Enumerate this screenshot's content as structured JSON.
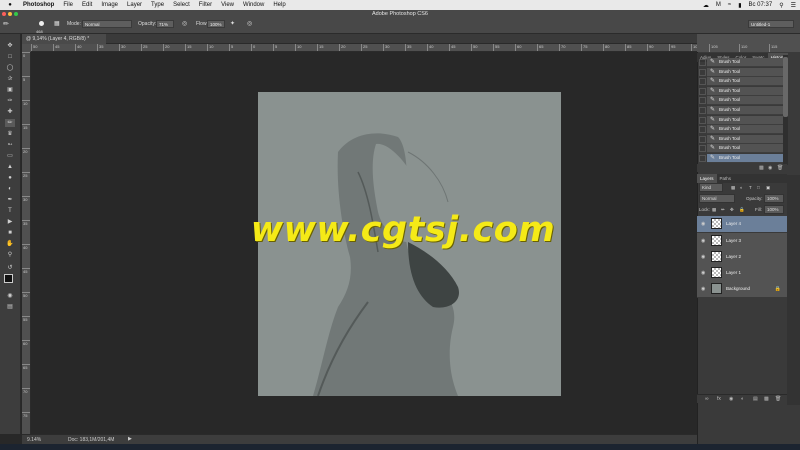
{
  "menubar": {
    "apple": "",
    "items": [
      "Photoshop",
      "File",
      "Edit",
      "Image",
      "Layer",
      "Type",
      "Select",
      "Filter",
      "View",
      "Window",
      "Help"
    ],
    "right_status": "Bc 07:37"
  },
  "window_title": "Adobe Photoshop CS6",
  "options": {
    "brush_size": "468",
    "mode_label": "Mode:",
    "mode_value": "Normal",
    "opacity_label": "Opacity:",
    "opacity_value": "71%",
    "flow_label": "Flow:",
    "flow_value": "100%",
    "workspace_value": "Untitled-1"
  },
  "document": {
    "tab_title": "@ 9,14% (Layer 4, RGB/8) *",
    "zoom": "9.14%",
    "doc_size": "Doc: 183,1M/201,4M",
    "watermark": "www.cgtsj.com"
  },
  "rulers": {
    "h_ticks": [
      "50",
      "45",
      "40",
      "35",
      "30",
      "25",
      "20",
      "15",
      "10",
      "5",
      "0",
      "5",
      "10",
      "15",
      "20",
      "25",
      "30",
      "35",
      "40",
      "45",
      "50",
      "55",
      "60",
      "65",
      "70",
      "75",
      "80",
      "85",
      "90",
      "95",
      "100"
    ],
    "right_ticks": [
      "105",
      "110",
      "115"
    ],
    "v_ticks": [
      "0",
      "5",
      "10",
      "15",
      "20",
      "25",
      "30",
      "35",
      "40",
      "45",
      "50",
      "55",
      "60",
      "65",
      "70",
      "75"
    ]
  },
  "history_panel": {
    "tabs": [
      "Adjus",
      "Styles",
      "Color",
      "Swatc",
      "History"
    ],
    "active_tab": "History",
    "items": [
      "Brush Tool",
      "Brush Tool",
      "Brush Tool",
      "Brush Tool",
      "Brush Tool",
      "Brush Tool",
      "Brush Tool",
      "Brush Tool",
      "Brush Tool",
      "Brush Tool",
      "Brush Tool"
    ]
  },
  "layers_panel": {
    "tabs": [
      "Layers",
      "Paths"
    ],
    "active_tab": "Layers",
    "filter_kind": "Kind",
    "blend_mode": "Normal",
    "opacity_label": "Opacity:",
    "opacity_value": "100%",
    "lock_label": "Lock:",
    "fill_label": "Fill:",
    "fill_value": "100%",
    "layers": [
      {
        "name": "Layer 4",
        "selected": true
      },
      {
        "name": "Layer 3",
        "selected": false
      },
      {
        "name": "Layer 2",
        "selected": false
      },
      {
        "name": "Layer 1",
        "selected": false
      },
      {
        "name": "Background",
        "selected": false
      }
    ],
    "footer_icons": [
      "link-icon",
      "fx-icon",
      "mask-icon",
      "adjustment-icon",
      "folder-icon",
      "new-layer-icon",
      "trash-icon"
    ]
  },
  "colors": {
    "menubar_bg": "#e9e9e9",
    "canvas_bg": "#8a9290",
    "watermark": "#f5ea17",
    "selection": "#6b7f99"
  }
}
